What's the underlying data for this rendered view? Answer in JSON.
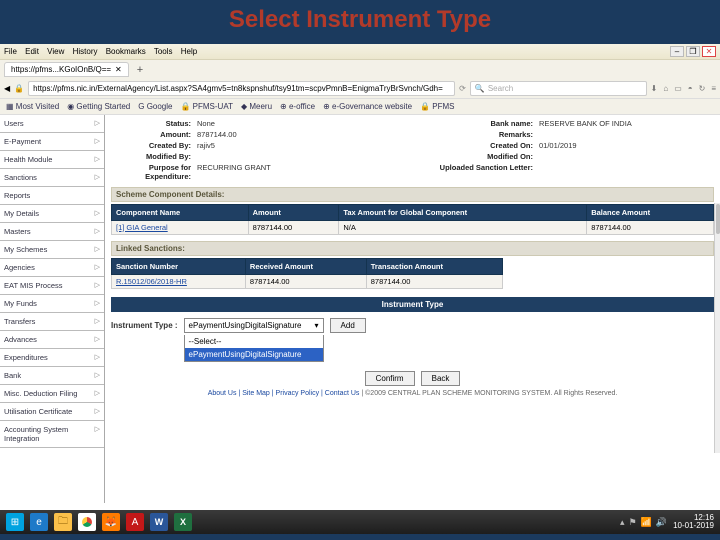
{
  "slide_title": "Select Instrument Type",
  "menubar": [
    "File",
    "Edit",
    "View",
    "History",
    "Bookmarks",
    "Tools",
    "Help"
  ],
  "tab_label": "https://pfms...KGoIOnB/Q==",
  "url": "https://pfms.nic.in/ExternalAgency/List.aspx?SA4gmv5=tn8kspnshuf/tsy91tm=scpvPmnB=EnigmaTryBrSvnch/Gdh=",
  "search_placeholder": "Search",
  "bookmarks": [
    "Most Visited",
    "Getting Started",
    "Google",
    "PFMS-UAT",
    "Meeru",
    "e-office",
    "e-Governance website",
    "PFMS"
  ],
  "sidebar": {
    "items": [
      {
        "label": "Users"
      },
      {
        "label": "E-Payment"
      },
      {
        "label": "Health Module"
      },
      {
        "label": "Sanctions"
      },
      {
        "label": "Reports"
      },
      {
        "label": "My Details"
      },
      {
        "label": "Masters"
      },
      {
        "label": "My Schemes"
      },
      {
        "label": "Agencies"
      },
      {
        "label": "EAT MIS Process"
      },
      {
        "label": "My Funds"
      },
      {
        "label": "Transfers"
      },
      {
        "label": "Advances"
      },
      {
        "label": "Expenditures"
      },
      {
        "label": "Bank"
      },
      {
        "label": "Misc. Deduction Filing"
      },
      {
        "label": "Utilisation Certificate"
      },
      {
        "label": "Accounting System Integration"
      }
    ]
  },
  "details": {
    "status_lbl": "Status:",
    "status_val": "None",
    "bank_lbl": "Bank name:",
    "bank_val": "RESERVE BANK OF INDIA",
    "amount_lbl": "Amount:",
    "amount_val": "8787144.00",
    "remarks_lbl": "Remarks:",
    "remarks_val": "",
    "createdby_lbl": "Created By:",
    "createdby_val": "rajiv5",
    "createdon_lbl": "Created On:",
    "createdon_val": "01/01/2019",
    "modby_lbl": "Modified By:",
    "modby_val": "",
    "modon_lbl": "Modified On:",
    "modon_val": "",
    "purpose_lbl": "Purpose for Expenditure:",
    "purpose_val": "RECURRING GRANT",
    "letter_lbl": "Uploaded Sanction Letter:",
    "letter_val": ""
  },
  "sec_scheme": "Scheme Component Details:",
  "comp_headers": [
    "Component Name",
    "Amount",
    "Tax Amount for Global Component",
    "Balance Amount"
  ],
  "comp_row": {
    "name": "[1] GIA General",
    "amount": "8787144.00",
    "tax": "N/A",
    "balance": "8787144.00"
  },
  "sec_linked": "Linked Sanctions:",
  "sanction_headers": [
    "Sanction Number",
    "Received Amount",
    "Transaction Amount"
  ],
  "sanction_row": {
    "num": "R.15012/06/2018-HR",
    "recv": "8787144.00",
    "txn": "8787144.00"
  },
  "instr_band": "Instrument Type",
  "instr_label": "Instrument Type :",
  "instr_selected": "ePaymentUsingDigitalSignature",
  "instr_options": [
    "--Select--",
    "ePaymentUsingDigitalSignature"
  ],
  "btn_add": "Add",
  "btn_confirm": "Confirm",
  "btn_back": "Back",
  "footer": {
    "links": "About Us | Site Map | Privacy Policy | Contact Us",
    "copy": "| ©2009 CENTRAL PLAN SCHEME MONITORING SYSTEM. All Rights Reserved."
  },
  "clock": {
    "time": "12:16",
    "date": "10-01-2019"
  }
}
